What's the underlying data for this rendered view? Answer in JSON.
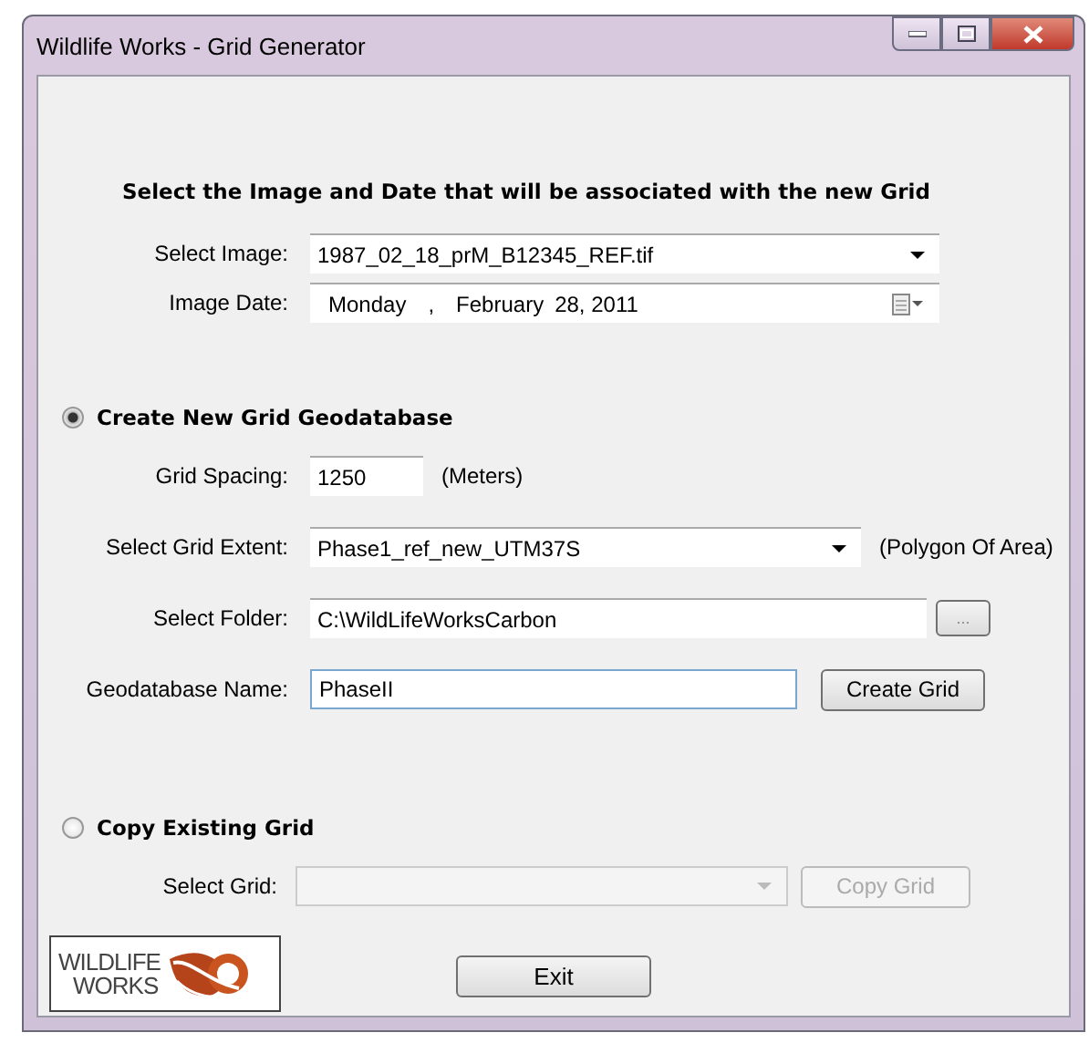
{
  "window": {
    "title": "Wildlife Works - Grid Generator"
  },
  "heading": "Select the Image and Date that will be associated with the new Grid",
  "image_fields": [
    {
      "kind": "combo",
      "label": "Select Image:",
      "value": "1987_02_18_prM_B12345_REF.tif"
    },
    {
      "kind": "date",
      "label": "Image Date:",
      "parts": [
        "Monday",
        ",",
        "February",
        "28, 2011"
      ]
    }
  ],
  "options": [
    {
      "label": "Create New Grid Geodatabase",
      "selected": true,
      "fields": [
        {
          "kind": "text",
          "label": "Grid Spacing:",
          "value": "1250",
          "unit": "(Meters)"
        },
        {
          "kind": "combo",
          "label": "Select Grid Extent:",
          "value": "Phase1_ref_new_UTM37S",
          "unit": "(Polygon Of Area)"
        },
        {
          "kind": "browse",
          "label": "Select Folder:",
          "value": "C:\\WildLifeWorksCarbon",
          "button": "..."
        },
        {
          "kind": "text",
          "label": "Geodatabase Name:",
          "value": "PhaseII",
          "button": "Create Grid",
          "focused": true
        }
      ]
    },
    {
      "label": "Copy Existing Grid",
      "selected": false,
      "fields": [
        {
          "kind": "combo",
          "label": "Select Grid:",
          "disabled": true,
          "button": "Copy Grid"
        }
      ]
    }
  ],
  "logo": {
    "lines": [
      "WILDLIFE",
      "WORKS"
    ]
  },
  "exit_button": "Exit"
}
